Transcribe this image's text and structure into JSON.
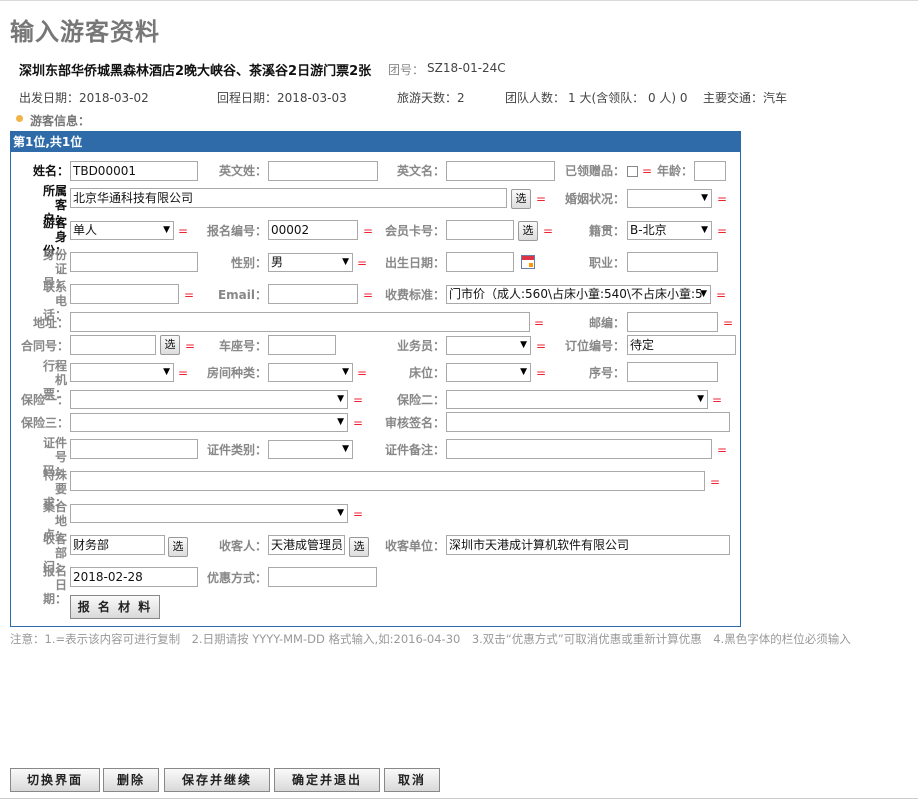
{
  "page_title": "输入游客资料",
  "tour": {
    "name": "深圳东部华侨城黑森林酒店2晚大峡谷、茶溪谷2日游门票2张",
    "group_label": "团号：",
    "group_no": "SZ18-01-24C",
    "depart_label": "出发日期：2018-03-02",
    "return_label": "回程日期：2018-03-03",
    "days_label": "旅游天数：2",
    "people_label": "团队人数：",
    "people_value": "1 大(含领队： 0 人) 0",
    "transport_label": "主要交通：汽车"
  },
  "section_label": "游客信息：",
  "panel_header": "第1位,共1位",
  "labels": {
    "name": "姓名：",
    "en_surname": "英文姓：",
    "en_name": "英文名：",
    "gift": "已领赠品：",
    "age": "年龄：",
    "client": "所属客户：",
    "marriage": "婚姻状况：",
    "identity": "游客身份：",
    "signup_no": "报名编号：",
    "member_card": "会员卡号：",
    "native": "籍贯：",
    "id_no": "身份证号：",
    "gender": "性别：",
    "birthday": "出生日期：",
    "job": "职业：",
    "phone": "联系电话：",
    "email": "Email：",
    "fee_std": "收费标准：",
    "address": "地址：",
    "zip": "邮编：",
    "contract": "合同号：",
    "seat": "车座号：",
    "salesman": "业务员：",
    "order_no": "订位编号：",
    "itinerary": "行程机票：",
    "room_type": "房间种类：",
    "bed": "床位：",
    "seq": "序号：",
    "ins1": "保险一：",
    "ins2": "保险二：",
    "ins3": "保险三：",
    "audit_sign": "审核签名：",
    "cert_no": "证件号码：",
    "cert_type": "证件类别：",
    "cert_note": "证件备注：",
    "special": "特殊要求：",
    "gather": "集合地点：",
    "recv_dept": "收客部门：",
    "receiver": "收客人：",
    "recv_unit": "收客单位：",
    "signup_date": "报名日期：",
    "discount": "优惠方式："
  },
  "values": {
    "name": "TBD00001",
    "client": "北京华通科技有限公司",
    "identity": "单人",
    "signup_no": "00002",
    "native": "B-北京",
    "gender": "男",
    "fee_std": "门市价（成人:560\\占床小童:540\\不占床小童:5",
    "order_no": "待定",
    "recv_dept": "财务部",
    "receiver": "天港成管理员",
    "recv_unit": "深圳市天港成计算机软件有限公司",
    "signup_date": "2018-02-28"
  },
  "eq": "=",
  "pick": "选",
  "material_button": "报 名 材 料",
  "note": "注意：1.=表示该内容可进行复制　2.日期请按 YYYY-MM-DD 格式输入,如:2016-04-30　3.双击“优惠方式”可取消优惠或重新计算优惠　4.黑色字体的栏位必须输入",
  "footer_buttons": {
    "switch": "切换界面",
    "delete": "删除",
    "save_continue": "保存并继续",
    "confirm_exit": "确定并退出",
    "cancel": "取消"
  },
  "colors": {
    "panel_header": "#2e6ba8",
    "eq": "#e23",
    "bullet": "#f2b347"
  }
}
